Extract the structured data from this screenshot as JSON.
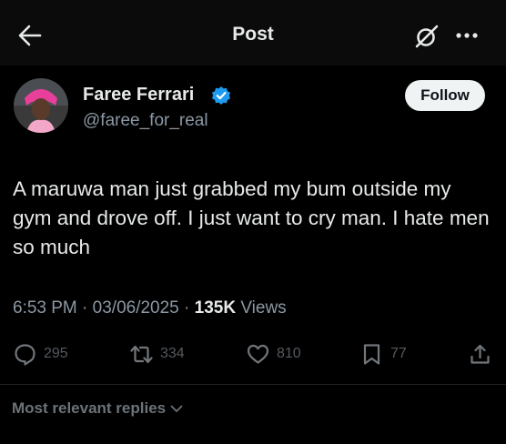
{
  "header": {
    "title": "Post",
    "icons": {
      "back": "arrow-left-icon",
      "grok": "grok-icon",
      "more": "more-dots-icon"
    }
  },
  "author": {
    "name": "Faree Ferrari",
    "handle": "@faree_for_real",
    "verified": true,
    "follow_label": "Follow"
  },
  "post": {
    "text": "A maruwa man just grabbed my bum outside my gym and drove off. I just want to cry man. I hate men so much",
    "time": "6:53 PM",
    "date": "03/06/2025",
    "views_count": "135K",
    "views_label": "Views"
  },
  "actions": {
    "replies": "295",
    "reposts": "334",
    "likes": "810",
    "bookmarks": "77"
  },
  "replies_sort": {
    "label": "Most relevant replies"
  },
  "colors": {
    "background": "#000000",
    "primary_text": "#e7e9ea",
    "secondary_text": "#8b98a5",
    "verified": "#1d9bf0",
    "follow_bg": "#eff3f4"
  }
}
